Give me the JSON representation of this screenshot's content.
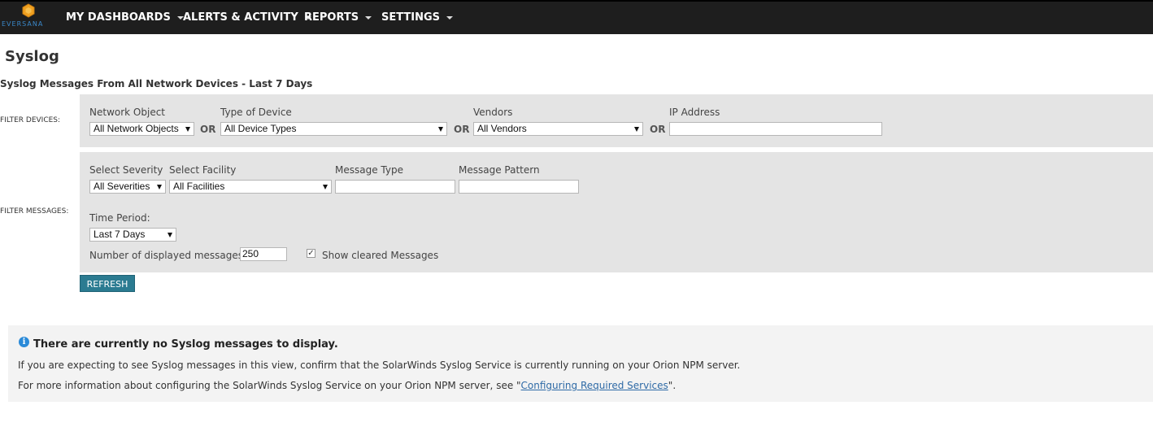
{
  "nav": {
    "logo_text": "EVERSANA",
    "items": [
      {
        "label": "MY DASHBOARDS"
      },
      {
        "label": "ALERTS & ACTIVITY"
      },
      {
        "label": "REPORTS"
      },
      {
        "label": "SETTINGS"
      }
    ]
  },
  "page": {
    "title": "Syslog",
    "subtitle": "Syslog Messages From All Network Devices - Last 7 Days"
  },
  "filter_devices": {
    "label": "FILTER DEVICES:",
    "network_object_label": "Network Object",
    "network_object_value": "All Network Objects",
    "type_label": "Type of Device",
    "type_value": "All Device Types",
    "vendors_label": "Vendors",
    "vendors_value": "All Vendors",
    "ip_label": "IP Address",
    "ip_value": "",
    "or_text": "OR"
  },
  "filter_messages": {
    "label": "FILTER MESSAGES:",
    "severity_label": "Select Severity",
    "severity_value": "All Severities",
    "facility_label": "Select Facility",
    "facility_value": "All Facilities",
    "message_type_label": "Message Type",
    "message_type_value": "",
    "message_pattern_label": "Message Pattern",
    "message_pattern_value": "",
    "time_period_label": "Time Period:",
    "time_period_value": "Last 7 Days",
    "num_messages_label": "Number of displayed messages:",
    "num_messages_value": "250",
    "show_cleared_label": "Show cleared Messages",
    "show_cleared_checked": true
  },
  "refresh_label": "REFRESH",
  "info": {
    "title": "There are currently no Syslog messages to display.",
    "line1": "If you are expecting to see Syslog messages in this view, confirm that the SolarWinds Syslog Service is currently running on your Orion NPM server.",
    "line2_prefix": "For more information about configuring the SolarWinds Syslog Service on your Orion NPM server, see \"",
    "line2_link": "Configuring Required Services",
    "line2_suffix": "\"."
  },
  "colors": {
    "topbar": "#1e1e1e",
    "panel": "#e4e4e4",
    "button": "#2b7b91",
    "info_icon": "#2a8ad8",
    "logo": "#f0a020"
  },
  "icons": {
    "logo": "eversana-logo-icon",
    "info": "info-icon",
    "dropdown": "chevron-down-icon"
  }
}
